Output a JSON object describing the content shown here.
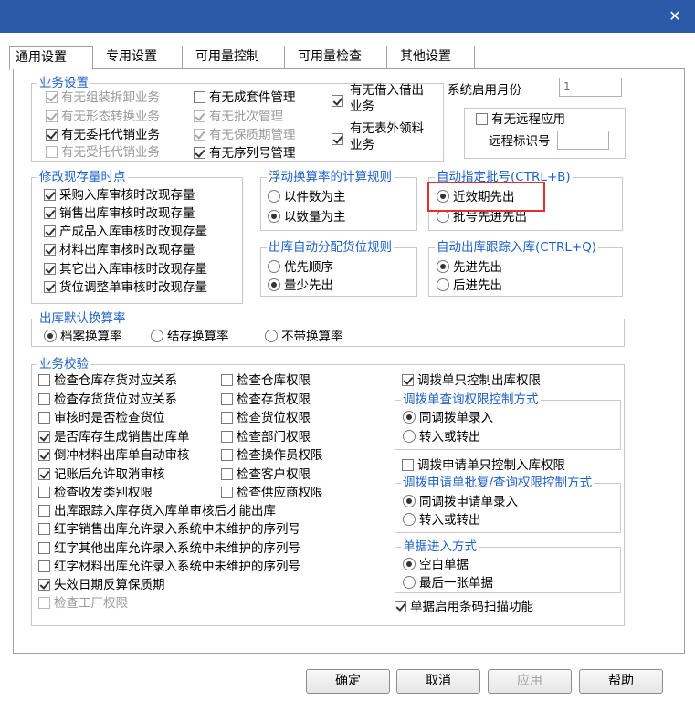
{
  "window": {
    "close_glyph": "✕"
  },
  "tabs": [
    "通用设置",
    "专用设置",
    "可用量控制",
    "可用量检查",
    "其他设置"
  ],
  "business_settings": {
    "legend": "业务设置",
    "col1": [
      {
        "label": "有无组装拆卸业务",
        "checked": true,
        "disabled": true
      },
      {
        "label": "有无形态转换业务",
        "checked": true,
        "disabled": true
      },
      {
        "label": "有无委托代销业务",
        "checked": true,
        "disabled": false
      },
      {
        "label": "有无受托代销业务",
        "checked": false,
        "disabled": true
      }
    ],
    "col2": [
      {
        "label": "有无成套件管理",
        "checked": false,
        "disabled": false
      },
      {
        "label": "有无批次管理",
        "checked": true,
        "disabled": true
      },
      {
        "label": "有无保质期管理",
        "checked": true,
        "disabled": true
      },
      {
        "label": "有无序列号管理",
        "checked": true,
        "disabled": false
      }
    ],
    "col3": [
      {
        "label_line1": "有无借入借出",
        "label_line2": "业务",
        "checked": true
      },
      {
        "label_line1": "有无表外领料",
        "label_line2": "业务",
        "checked": true
      }
    ]
  },
  "system_start_month": {
    "label": "系统启用月份",
    "value": "1"
  },
  "remote": {
    "label": "有无远程应用",
    "checked": false,
    "id_label": "远程标识号",
    "id_value": ""
  },
  "modify_stock_time": {
    "legend": "修改现存量时点",
    "items": [
      {
        "label": "采购入库审核时改现存量",
        "checked": true
      },
      {
        "label": "销售出库审核时改现存量",
        "checked": true
      },
      {
        "label": "产成品入库审核时改现存量",
        "checked": true
      },
      {
        "label": "材料出库审核时改现存量",
        "checked": true
      },
      {
        "label": "其它出入库审核时改现存量",
        "checked": true
      },
      {
        "label": "货位调整单审核时改现存量",
        "checked": true
      }
    ]
  },
  "floating_conversion": {
    "legend": "浮动换算率的计算规则",
    "options": [
      {
        "label": "以件数为主",
        "checked": false
      },
      {
        "label": "以数量为主",
        "checked": true
      }
    ]
  },
  "auto_batch": {
    "legend": "自动指定批号(CTRL+B)",
    "options": [
      {
        "label": "近效期先出",
        "checked": true
      },
      {
        "label": "批号先进先出",
        "checked": false
      }
    ]
  },
  "outbound_location": {
    "legend": "出库自动分配货位规则",
    "options": [
      {
        "label": "优先顺序",
        "checked": false
      },
      {
        "label": "量少先出",
        "checked": true
      }
    ]
  },
  "outbound_tracking": {
    "legend": "自动出库跟踪入库(CTRL+Q)",
    "options": [
      {
        "label": "先进先出",
        "checked": true
      },
      {
        "label": "后进先出",
        "checked": false
      }
    ]
  },
  "default_conversion": {
    "legend": "出库默认换算率",
    "options": [
      {
        "label": "档案换算率",
        "checked": true
      },
      {
        "label": "结存换算率",
        "checked": false
      },
      {
        "label": "不带换算率",
        "checked": false
      }
    ]
  },
  "business_check": {
    "legend": "业务校验",
    "col1": [
      {
        "label": "检查仓库存货对应关系",
        "checked": false,
        "disabled": false
      },
      {
        "label": "检查存货货位对应关系",
        "checked": false,
        "disabled": false
      },
      {
        "label": "审核时是否检查货位",
        "checked": false,
        "disabled": false
      },
      {
        "label": "是否库存生成销售出库单",
        "checked": true,
        "disabled": false
      },
      {
        "label": "倒冲材料出库单自动审核",
        "checked": true,
        "disabled": false
      },
      {
        "label": "记账后允许取消审核",
        "checked": true,
        "disabled": false
      },
      {
        "label": "检查收发类别权限",
        "checked": false,
        "disabled": false
      },
      {
        "label": "出库跟踪入库存货入库单审核后才能出库",
        "checked": false,
        "disabled": false
      },
      {
        "label": "红字销售出库允许录入系统中未维护的序列号",
        "checked": false,
        "disabled": false
      },
      {
        "label": "红字其他出库允许录入系统中未维护的序列号",
        "checked": false,
        "disabled": false
      },
      {
        "label": "红字材料出库允许录入系统中未维护的序列号",
        "checked": false,
        "disabled": false
      },
      {
        "label": "失效日期反算保质期",
        "checked": true,
        "disabled": false
      },
      {
        "label": "检查工厂权限",
        "checked": false,
        "disabled": true
      }
    ],
    "col2": [
      {
        "label": "检查仓库权限",
        "checked": false
      },
      {
        "label": "检查存货权限",
        "checked": false
      },
      {
        "label": "检查货位权限",
        "checked": false
      },
      {
        "label": "检查部门权限",
        "checked": false
      },
      {
        "label": "检查操作员权限",
        "checked": false
      },
      {
        "label": "检查客户权限",
        "checked": false
      },
      {
        "label": "检查供应商权限",
        "checked": false
      }
    ]
  },
  "transfer": {
    "outbound_only": {
      "label": "调拨单只控制出库权限",
      "checked": true
    },
    "query_ctrl": {
      "legend": "调拨单查询权限控制方式",
      "options": [
        {
          "label": "同调拨单录入",
          "checked": true
        },
        {
          "label": "转入或转出",
          "checked": false
        }
      ]
    },
    "request_inbound_only": {
      "label": "调拨申请单只控制入库权限",
      "checked": false
    },
    "request_ctrl": {
      "legend": "调拨申请单批复/查询权限控制方式",
      "options": [
        {
          "label": "同调拨申请单录入",
          "checked": true
        },
        {
          "label": "转入或转出",
          "checked": false
        }
      ]
    },
    "entry_mode": {
      "legend": "单据进入方式",
      "options": [
        {
          "label": "空白单据",
          "checked": true
        },
        {
          "label": "最后一张单据",
          "checked": false
        }
      ]
    },
    "barcode": {
      "label": "单据启用条码扫描功能",
      "checked": true
    }
  },
  "buttons": [
    {
      "label": "确定",
      "disabled": false
    },
    {
      "label": "取消",
      "disabled": false
    },
    {
      "label": "应用",
      "disabled": true
    },
    {
      "label": "帮助",
      "disabled": false
    }
  ]
}
